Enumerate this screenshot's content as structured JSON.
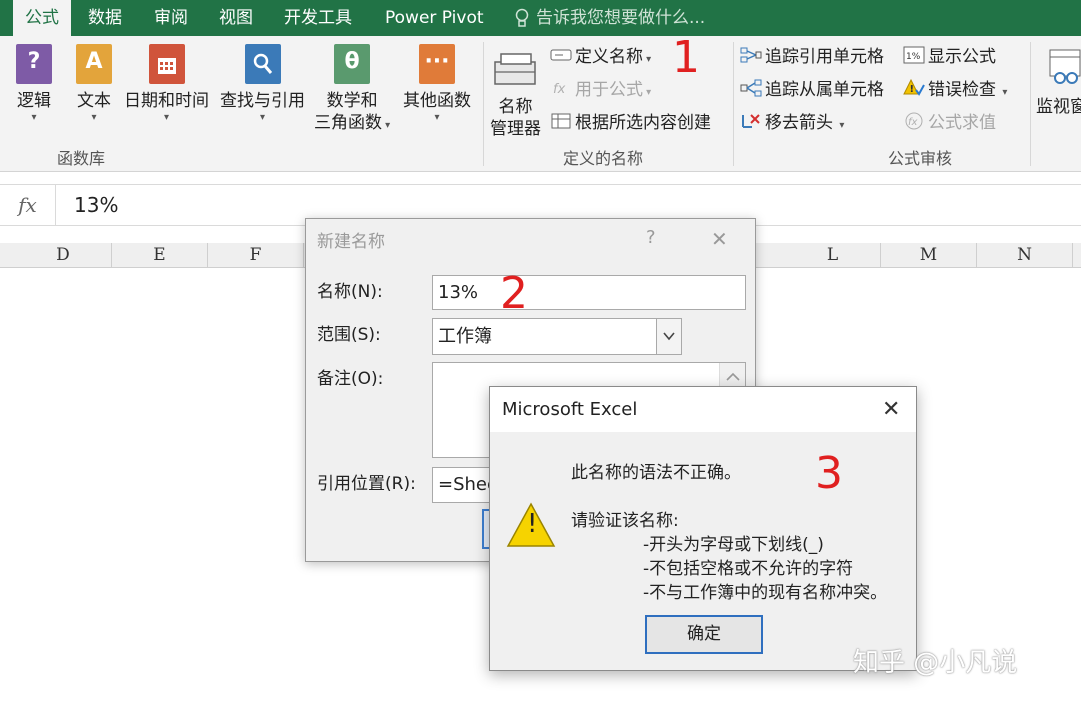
{
  "tabs": [
    "公式",
    "数据",
    "审阅",
    "视图",
    "开发工具",
    "Power Pivot"
  ],
  "tell_me": "告诉我您想要做什么...",
  "function_library": {
    "buttons": [
      {
        "label": "逻辑",
        "glyph": "?",
        "color": "#7e5ba6"
      },
      {
        "label": "文本",
        "glyph": "A",
        "color": "#e3a43b"
      },
      {
        "label": "日期和时间",
        "glyph": "",
        "color": "#d0543b"
      },
      {
        "label": "查找与引用",
        "glyph": "",
        "color": "#3b7ab8"
      },
      {
        "label_line1": "数学和",
        "label_line2": "三角函数",
        "glyph": "θ",
        "color": "#5a9a6e"
      },
      {
        "label": "其他函数",
        "glyph": "···",
        "color": "#e07b39"
      }
    ],
    "group_label": "函数库"
  },
  "defined_names": {
    "name_manager_line1": "名称",
    "name_manager_line2": "管理器",
    "define_name": "定义名称",
    "use_in_formula": "用于公式",
    "create_from_selection": "根据所选内容创建",
    "group_label": "定义的名称"
  },
  "formula_auditing": {
    "trace_precedents": "追踪引用单元格",
    "trace_dependents": "追踪从属单元格",
    "remove_arrows": "移去箭头",
    "show_formulas": "显示公式",
    "error_checking": "错误检查",
    "evaluate_formula": "公式求值",
    "watch_window": "监视窗",
    "group_label": "公式审核"
  },
  "formula_bar": {
    "fx": "fx",
    "value": "13%"
  },
  "columns": [
    "D",
    "E",
    "F",
    "L",
    "M",
    "N"
  ],
  "new_name_dialog": {
    "title": "新建名称",
    "help": "?",
    "close": "✕",
    "name_label": "名称(N):",
    "name_value": "13%",
    "scope_label": "范围(S):",
    "scope_value": "工作簿",
    "comment_label": "备注(O):",
    "refers_label": "引用位置(R):",
    "refers_value": "=Shee"
  },
  "error_box": {
    "title": "Microsoft Excel",
    "close": "✕",
    "line_main": "此名称的语法不正确。",
    "line_check": "请验证该名称:",
    "rule1": "-开头为字母或下划线(_)",
    "rule2": "-不包括空格或不允许的字符",
    "rule3": "-不与工作簿中的现有名称冲突。",
    "ok_label": "确定",
    "warn_glyph": "!"
  },
  "annotations": [
    "1",
    "2",
    "3"
  ],
  "watermark": "知乎 @小凡说"
}
